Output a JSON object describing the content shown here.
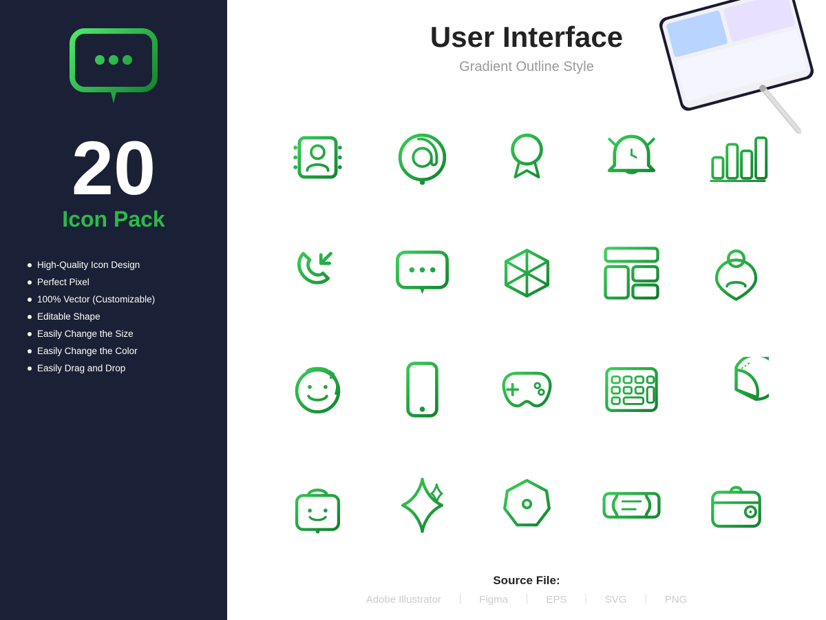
{
  "sidebar": {
    "number": "20",
    "pack_label": "Icon Pack",
    "features": [
      "High-Quality Icon Design",
      "Perfect Pixel",
      "100% Vector (Customizable)",
      "Editable Shape",
      "Easily Change the Size",
      "Easily Change the Color",
      "Easily Drag and Drop"
    ]
  },
  "main": {
    "title": "User Interface",
    "subtitle": "Gradient Outline Style",
    "source_label": "Source File:",
    "formats": [
      "Adobe Illustrator",
      "Figma",
      "EPS",
      "SVG",
      "PNG"
    ]
  },
  "colors": {
    "green": "#1a9e3a",
    "dark_green": "#0d7a2a",
    "sidebar_bg": "#1a2035"
  }
}
